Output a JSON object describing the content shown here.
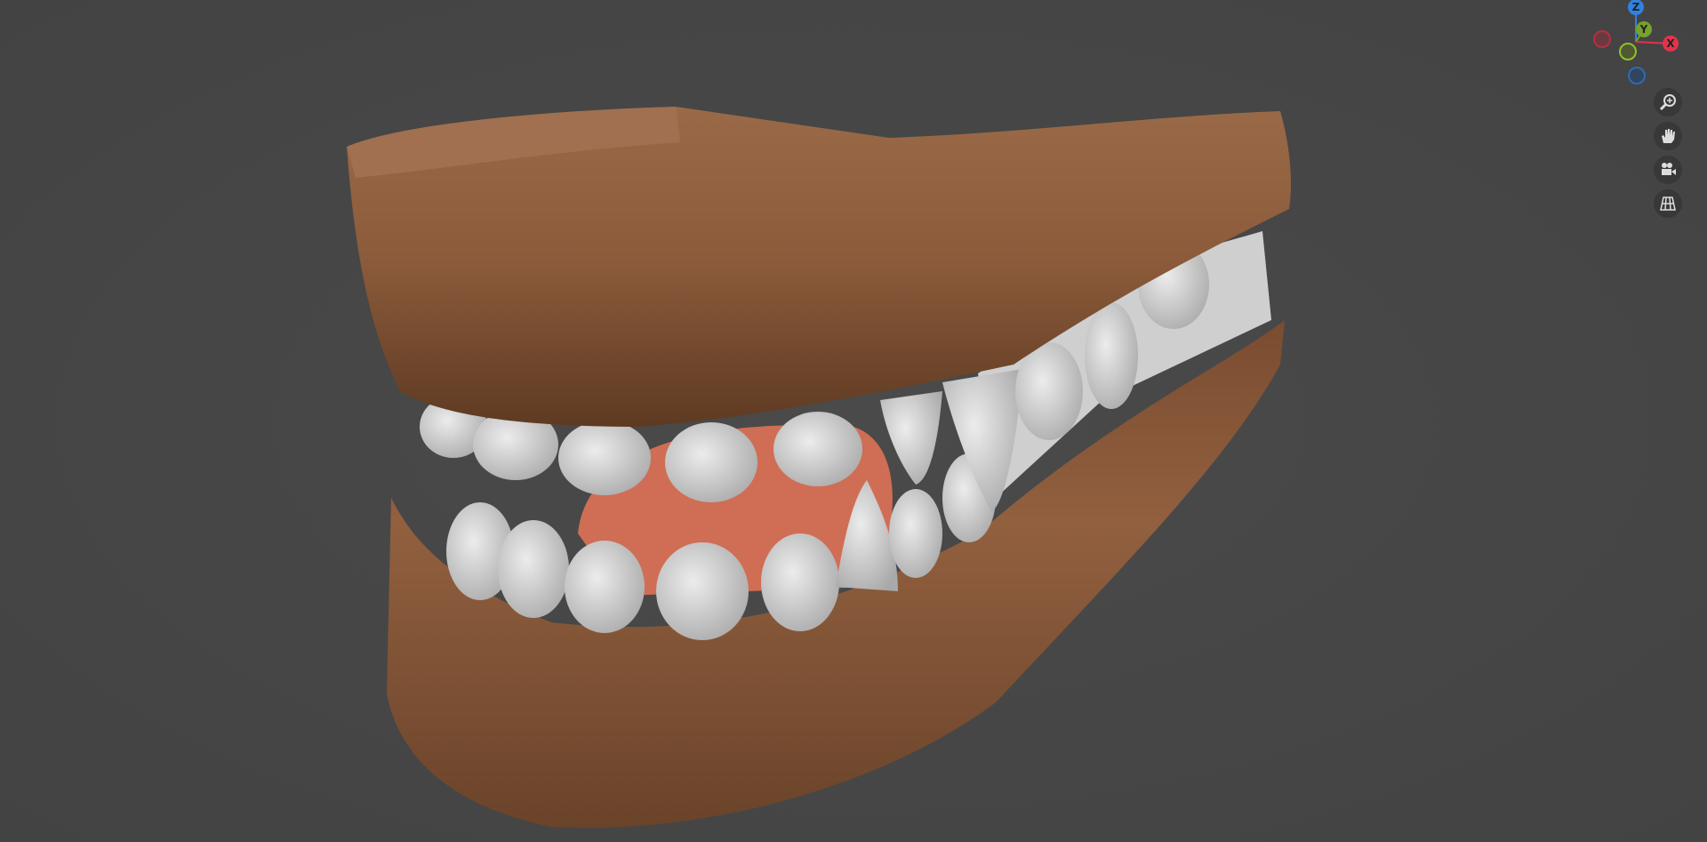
{
  "viewport": {
    "gizmo": {
      "x_label": "X",
      "y_label": "Y",
      "z_label": "Z",
      "colors": {
        "x": "#e0344c",
        "y": "#76a32a",
        "z": "#2e82e0"
      }
    },
    "nav_buttons": [
      {
        "icon": "zoom-icon"
      },
      {
        "icon": "pan-hand-icon"
      },
      {
        "icon": "camera-icon"
      },
      {
        "icon": "grid-ortho-icon"
      }
    ],
    "model_colors": {
      "gum": "#8a5a3a",
      "teeth": "#d9d9d9",
      "tongue": "#d0705a"
    }
  }
}
